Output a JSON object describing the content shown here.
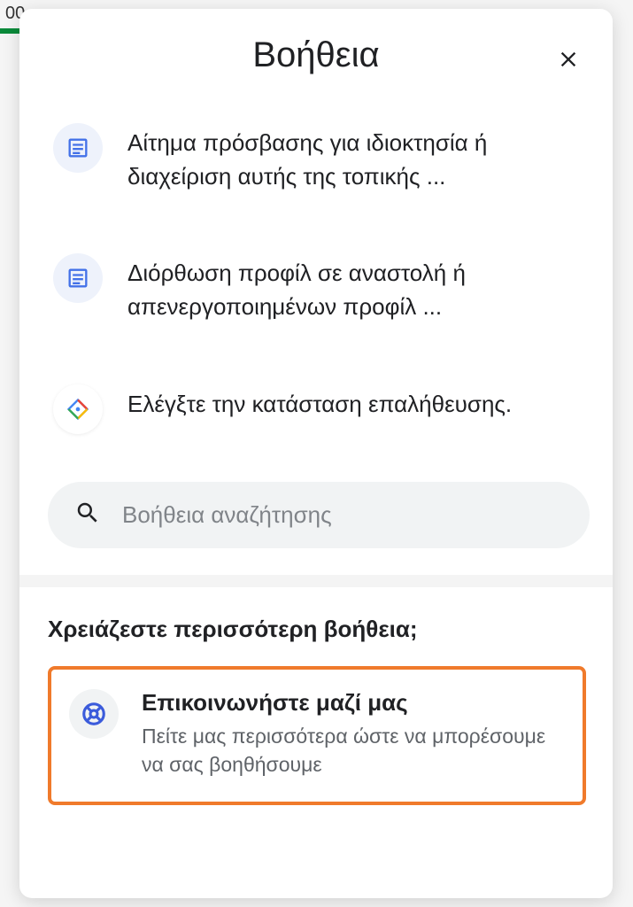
{
  "background_fragment": "00",
  "header": {
    "title": "Βοήθεια"
  },
  "help_items": [
    {
      "icon": "article",
      "text": "Αίτημα πρόσβασης για ιδιοκτησία ή διαχείριση αυτής της τοπικής ..."
    },
    {
      "icon": "article",
      "text": "Διόρθωση προφίλ σε αναστολή ή απενεργοποιημένων προφίλ ..."
    },
    {
      "icon": "diamond",
      "text": "Ελέγξτε την κατάσταση επαλήθευσης."
    }
  ],
  "search": {
    "placeholder": "Βοήθεια αναζήτησης"
  },
  "more_help": {
    "title": "Χρειάζεστε περισσότερη βοήθεια;",
    "contact_title": "Επικοινωνήστε μαζί μας",
    "contact_sub": "Πείτε μας περισσότερα ώστε να μπορέσουμε να σας βοηθήσουμε"
  }
}
